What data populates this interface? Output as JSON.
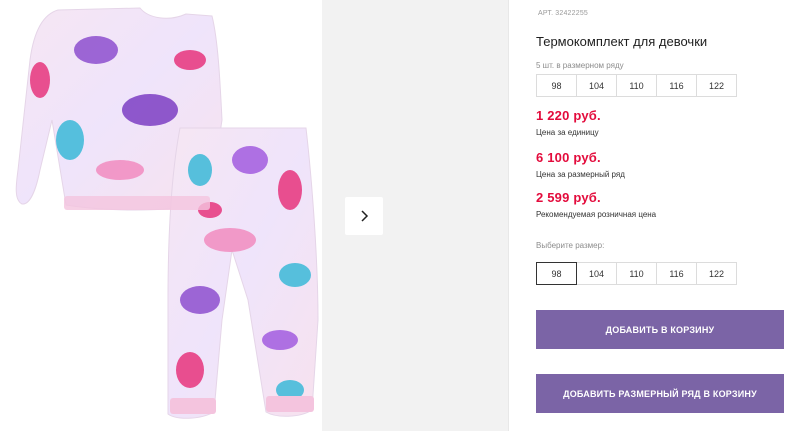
{
  "product": {
    "article_label": "АРТ.",
    "article_number": "32422255",
    "title": "Термокомплект для девочки",
    "image_alt": "pajama-set-photo"
  },
  "size_row": {
    "label": "5 шт. в размерном ряду",
    "sizes": [
      "98",
      "104",
      "110",
      "116",
      "122"
    ]
  },
  "prices": [
    {
      "value": "1 220 руб.",
      "note": "Цена за единицу"
    },
    {
      "value": "6 100 руб.",
      "note": "Цена за размерный ряд"
    },
    {
      "value": "2 599 руб.",
      "note": "Рекомендуемая розничная цена"
    }
  ],
  "size_picker": {
    "label": "Выберите размер:",
    "sizes": [
      "98",
      "104",
      "110",
      "116",
      "122"
    ],
    "selected": "98"
  },
  "buttons": {
    "add_to_cart": "ДОБАВИТЬ В КОРЗИНУ",
    "add_size_row": "ДОБАВИТЬ РАЗМЕРНЫЙ РЯД В КОРЗИНУ"
  },
  "icons": {
    "next": "chevron-right-icon"
  },
  "colors": {
    "price": "#e30b3c",
    "button": "#7b64a6"
  }
}
